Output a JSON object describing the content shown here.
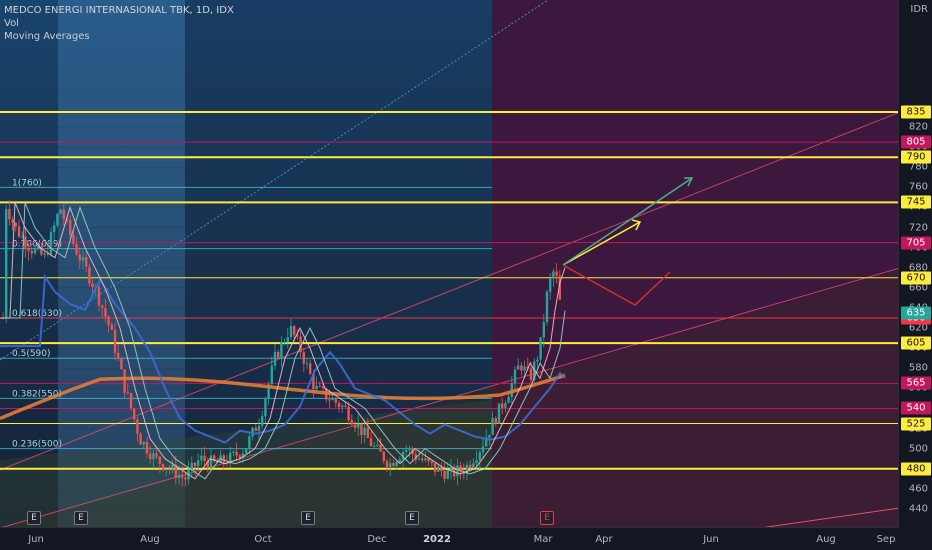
{
  "legend": {
    "title": "MEDCO ENERGI INTERNASIONAL TBK, 1D, IDX",
    "vol": "Vol",
    "ma": "Moving Averages"
  },
  "currency": "IDR",
  "chart_data": {
    "type": "candlestick",
    "symbol": "MEDCO ENERGI INTERNASIONAL TBK",
    "interval": "1D",
    "exchange": "IDX",
    "y_range": [
      430,
      840
    ],
    "y_ticks": [
      440,
      460,
      480,
      500,
      520,
      540,
      560,
      580,
      600,
      620,
      640,
      660,
      680,
      700,
      720,
      740,
      760,
      780,
      800,
      820
    ],
    "x_labels": [
      {
        "label": "Jun",
        "bold": false
      },
      {
        "label": "Aug",
        "bold": false
      },
      {
        "label": "Oct",
        "bold": false
      },
      {
        "label": "Dec",
        "bold": false
      },
      {
        "label": "2022",
        "bold": true
      },
      {
        "label": "Mar",
        "bold": false
      },
      {
        "label": "Apr",
        "bold": false
      },
      {
        "label": "Jun",
        "bold": false
      },
      {
        "label": "Aug",
        "bold": false
      },
      {
        "label": "Sep",
        "bold": false
      }
    ],
    "fib_levels": [
      {
        "label": "1(760)",
        "value": 760
      },
      {
        "label": "0.786(699)",
        "value": 699
      },
      {
        "label": "0.618(630)",
        "value": 630
      },
      {
        "label": "0.5(590)",
        "value": 590
      },
      {
        "label": "0.382(550)",
        "value": 550
      },
      {
        "label": "0.236(500)",
        "value": 500
      }
    ],
    "horizontal_levels": [
      {
        "value": 835,
        "label": "835",
        "color": "#ffeb3b"
      },
      {
        "value": 805,
        "label": "805",
        "color": "#c2185b"
      },
      {
        "value": 790,
        "label": "790",
        "color": "#ffeb3b"
      },
      {
        "value": 745,
        "label": "745",
        "color": "#ffeb3b"
      },
      {
        "value": 705,
        "label": "705",
        "color": "#c2185b"
      },
      {
        "value": 670,
        "label": "670",
        "color": "#ffeb3b"
      },
      {
        "value": 630,
        "label": "630",
        "color": "#f23645"
      },
      {
        "value": 605,
        "label": "605",
        "color": "#ffeb3b"
      },
      {
        "value": 565,
        "label": "565",
        "color": "#c2185b"
      },
      {
        "value": 540,
        "label": "540",
        "color": "#c2185b"
      },
      {
        "value": 525,
        "label": "525",
        "color": "#ffeb3b"
      },
      {
        "value": 480,
        "label": "480",
        "color": "#ffeb3b"
      }
    ],
    "last_price": {
      "value": 635,
      "label": "635"
    },
    "events": [
      "E",
      "E",
      "E",
      "E",
      "E"
    ]
  },
  "colors": {
    "up": "#26a69a",
    "down": "#ef5350",
    "fib": "#4dd0e1",
    "ma_slow": "#e07b39"
  }
}
